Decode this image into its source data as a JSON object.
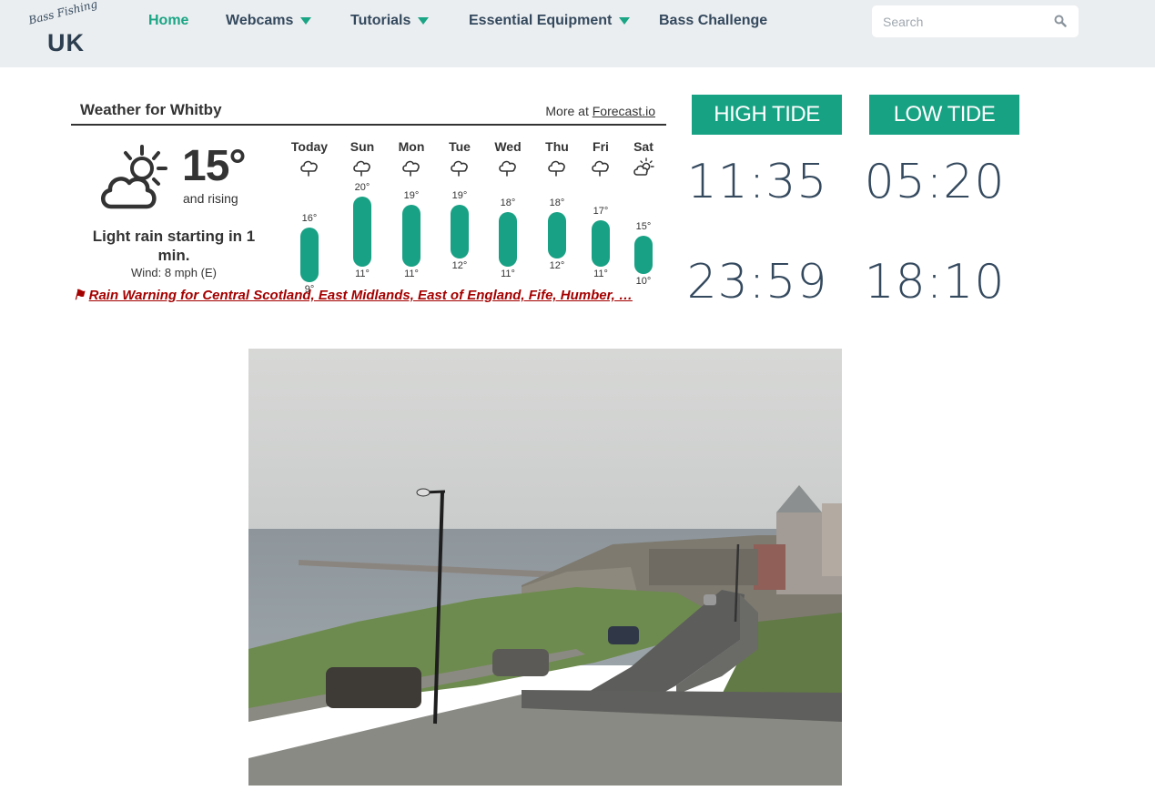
{
  "header": {
    "logo_script": "Bass Fishing",
    "logo_main": "UK",
    "nav": [
      {
        "label": "Home",
        "active": true,
        "dropdown": false
      },
      {
        "label": "Webcams",
        "active": false,
        "dropdown": true
      },
      {
        "label": "Tutorials",
        "active": false,
        "dropdown": true
      },
      {
        "label": "Essential Equipment",
        "active": false,
        "dropdown": true
      },
      {
        "label": "Bass Challenge",
        "active": false,
        "dropdown": false
      }
    ],
    "search_placeholder": "Search"
  },
  "weather": {
    "title": "Weather for Whitby",
    "more_prefix": "More at ",
    "more_link": "Forecast.io",
    "current": {
      "icon": "partly-cloudy-day-icon",
      "temp": "15°",
      "trend": "and rising",
      "summary": "Light rain starting in 1 min.",
      "wind": "Wind: 8 mph (E)"
    },
    "forecast": [
      {
        "day": "Today",
        "icon": "rain-icon",
        "high": "16°",
        "low": "9°",
        "high_val": 16,
        "low_val": 9
      },
      {
        "day": "Sun",
        "icon": "rain-icon",
        "high": "20°",
        "low": "11°",
        "high_val": 20,
        "low_val": 11
      },
      {
        "day": "Mon",
        "icon": "rain-icon",
        "high": "19°",
        "low": "11°",
        "high_val": 19,
        "low_val": 11
      },
      {
        "day": "Tue",
        "icon": "rain-icon",
        "high": "19°",
        "low": "12°",
        "high_val": 19,
        "low_val": 12
      },
      {
        "day": "Wed",
        "icon": "rain-icon",
        "high": "18°",
        "low": "11°",
        "high_val": 18,
        "low_val": 11
      },
      {
        "day": "Thu",
        "icon": "rain-icon",
        "high": "18°",
        "low": "12°",
        "high_val": 18,
        "low_val": 12
      },
      {
        "day": "Fri",
        "icon": "rain-icon",
        "high": "17°",
        "low": "11°",
        "high_val": 17,
        "low_val": 11
      },
      {
        "day": "Sat",
        "icon": "partly-cloudy-day-icon",
        "high": "15°",
        "low": "10°",
        "high_val": 15,
        "low_val": 10
      }
    ],
    "alert": {
      "flag": "⚑",
      "text": "Rain Warning for Central Scotland, East Midlands, East of England, Fife, Humber, …"
    }
  },
  "tides": {
    "high_label": "HIGH TIDE",
    "low_label": "LOW TIDE",
    "high_times": [
      "11:35",
      "23:59"
    ],
    "low_times": [
      "05:20",
      "18:10"
    ]
  },
  "colors": {
    "accent": "#17a283",
    "nav_text": "#34495e",
    "header_bg": "#ebeef0",
    "alert": "#a50000"
  }
}
